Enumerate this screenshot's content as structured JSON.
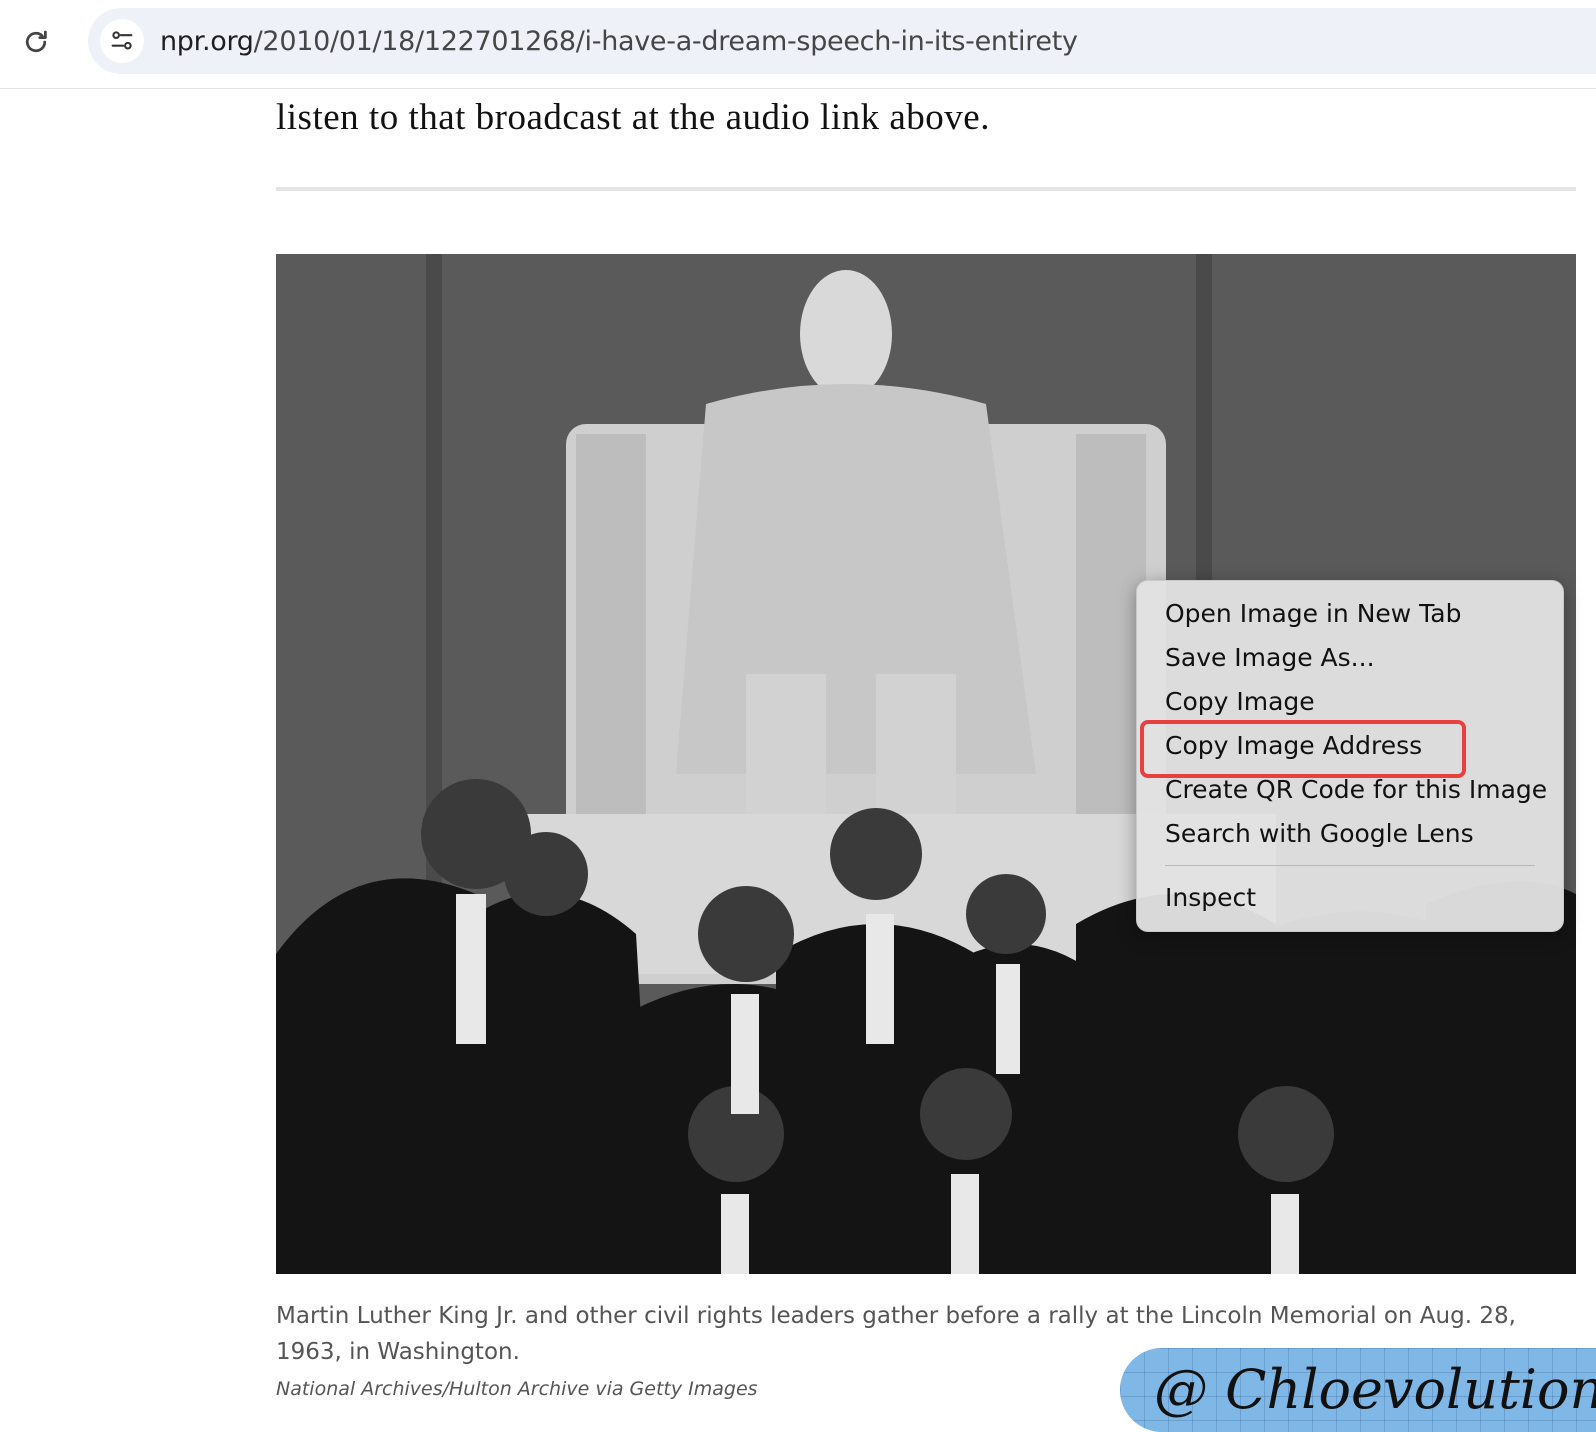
{
  "browser": {
    "url_host": "npr.org",
    "url_path": "/2010/01/18/122701268/i-have-a-dream-speech-in-its-entirety"
  },
  "article": {
    "lead_text": "listen to that broadcast at the audio link above.",
    "caption": "Martin Luther King Jr. and other civil rights leaders gather before a rally at the Lincoln Memorial on Aug. 28, 1963, in Washington.",
    "credit": "National Archives/Hulton Archive via Getty Images"
  },
  "context_menu": {
    "items": [
      "Open Image in New Tab",
      "Save Image As...",
      "Copy Image",
      "Copy Image Address",
      "Create QR Code for this Image",
      "Search with Google Lens",
      "Inspect"
    ],
    "highlighted_item": "Copy Image Address"
  },
  "watermark": {
    "text": "@ Chloevolution"
  },
  "colors": {
    "highlight_border": "#e8403e",
    "omnibox_bg": "#eef1f8",
    "watermark_bg": "#7fb8e6"
  }
}
